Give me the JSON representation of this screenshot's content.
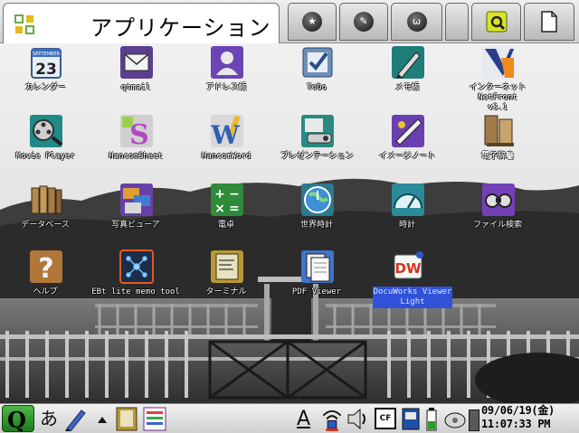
{
  "launcher": {
    "active_tab": {
      "title": "アプリケーション",
      "icon": "grid-icon"
    },
    "tabs": [
      {
        "icon": "star-icon"
      },
      {
        "icon": "wrench-icon"
      },
      {
        "icon": "games-icon"
      },
      {
        "icon": "blank-tab-icon"
      },
      {
        "icon": "settings-icon"
      },
      {
        "icon": "document-icon"
      }
    ]
  },
  "apps": [
    {
      "label": "カレンダー",
      "icon": "calendar-icon",
      "day": "23",
      "calendar_caption": "SEPTEMBER"
    },
    {
      "label": "qtmail",
      "icon": "mail-icon"
    },
    {
      "label": "アドレス帳",
      "icon": "address-book-icon"
    },
    {
      "label": "ToDo",
      "icon": "todo-icon"
    },
    {
      "label": "メモ帳",
      "icon": "memo-pad-icon"
    },
    {
      "label": "インターネット NetFront\nv3.1",
      "icon": "netfront-icon"
    },
    {
      "label": "Movie Player",
      "icon": "movie-player-icon"
    },
    {
      "label": "HancomSheet",
      "icon": "hancomsheet-icon"
    },
    {
      "label": "HancomWord",
      "icon": "hancomword-icon"
    },
    {
      "label": "プレゼンテーション",
      "icon": "presentation-icon"
    },
    {
      "label": "イメージノート",
      "icon": "image-note-icon"
    },
    {
      "label": "電子辞書",
      "icon": "dictionary-icon"
    },
    {
      "label": "データベース",
      "icon": "database-icon"
    },
    {
      "label": "写真ビューア",
      "icon": "photo-viewer-icon"
    },
    {
      "label": "電卓",
      "icon": "calculator-icon"
    },
    {
      "label": "世界時計",
      "icon": "world-clock-icon"
    },
    {
      "label": "時計",
      "icon": "clock-icon"
    },
    {
      "label": "ファイル検索",
      "icon": "file-search-icon"
    },
    {
      "label": "ヘルプ",
      "icon": "help-icon"
    },
    {
      "label": "EBt lite memo tool",
      "icon": "ebt-memo-tool-icon"
    },
    {
      "label": "ターミナル",
      "icon": "terminal-icon"
    },
    {
      "label": "PDF Viewer",
      "icon": "pdf-viewer-icon"
    },
    {
      "label": "DocuWorks Viewer\nLight",
      "icon": "docuworks-icon",
      "icon_text": "DW"
    }
  ],
  "taskbar": {
    "start_button": "Q",
    "ime_mode": "あ",
    "input_indicator": "A",
    "storage_label": "CF",
    "clock_date": "09/06/19(金)",
    "clock_time": "11:07:33 PM"
  },
  "colors": {
    "selection": "#2f52d8",
    "tab_background": "#d0d0d0",
    "start_button": "#2e9a2a"
  }
}
